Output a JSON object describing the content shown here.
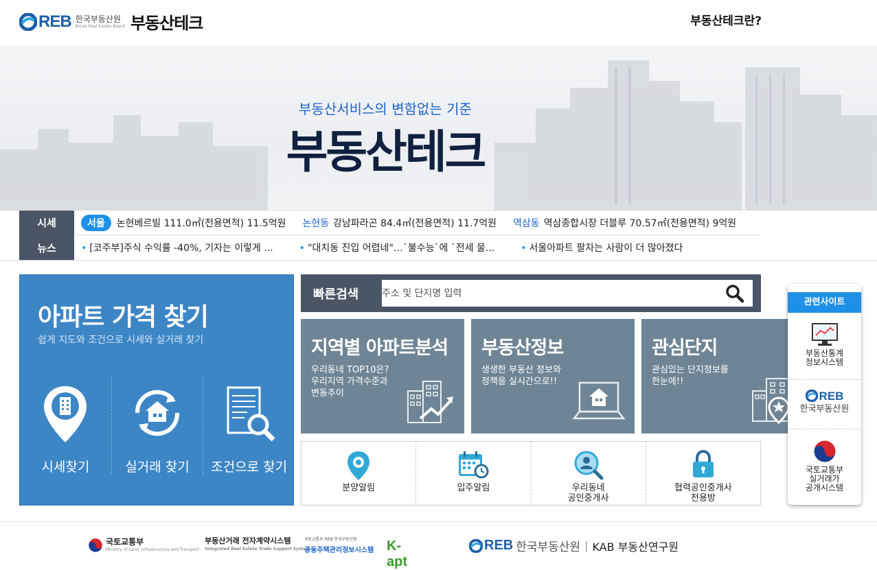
{
  "header": {
    "logo_reb": "REB",
    "logo_kor": "한국부동산원",
    "logo_eng": "Korea Real Estate Board",
    "brand": "부동산테크",
    "about_link": "부동산테크란?"
  },
  "hero": {
    "subtitle": "부동산서비스의 변함없는 기준",
    "title": "부동산테크"
  },
  "ticker": {
    "price_label": "시세",
    "news_label": "뉴스",
    "seoul_pill": "서울",
    "prices": [
      {
        "region": "",
        "text": "논현베르빌  111.0㎡(전용면적)  11.5억원"
      },
      {
        "region": "논현동",
        "text": "강남파라곤  84.4㎡(전용면적)  11.7억원"
      },
      {
        "region": "역삼동",
        "text": "역삼종합시장 더블루  70.57㎡(전용면적)  9억원"
      }
    ],
    "news": [
      "[코주부]주식 수익률 -40%, 기자는 이렇게 ...",
      "\"대치동 진입 어렵네\"…`불수능`에 `전세 물...",
      "서울아파트 팔자는 사람이 더 많아졌다"
    ]
  },
  "apt_panel": {
    "title": "아파트 가격 찾기",
    "subtitle": "쉽게 지도와 조건으로 시세와 실거래 찾기",
    "items": [
      "시세찾기",
      "실거래 찾기",
      "조건으로 찾기"
    ]
  },
  "quick_search": {
    "label": "빠른검색",
    "placeholder": "주소 및 단지명 입력"
  },
  "cards": [
    {
      "title": "지역별 아파트분석",
      "desc": "우리동네 TOP10은?\n우리지역 가격수준과\n변동추이",
      "icon": "chart-building-icon"
    },
    {
      "title": "부동산정보",
      "desc": "생생한 부동산 정보와\n정책을 실시간으로!!",
      "icon": "laptop-house-icon"
    },
    {
      "title": "관심단지",
      "desc": "관심있는 단지정보를\n한눈에!!",
      "icon": "star-building-icon"
    }
  ],
  "icon_links": [
    {
      "label": "분양알림",
      "icon": "location-pin-icon"
    },
    {
      "label": "입주알림",
      "icon": "calendar-clock-icon"
    },
    {
      "label": "우리동네\n공인중개사",
      "icon": "person-search-icon"
    },
    {
      "label": "협력공인중개사\n전용방",
      "icon": "lock-icon"
    }
  ],
  "related": {
    "header": "관련사이트",
    "items": [
      {
        "label": "부동산통계\n정보시스템"
      },
      {
        "label": "한국부동산원"
      },
      {
        "label": "국토교통부\n실거래가\n공개시스템"
      }
    ]
  },
  "footer": {
    "molit": "국토교통부",
    "molit_sub": "Ministry of Land, Infrastructure and Transport",
    "contract": "부동산거래 전자계약시스템",
    "contract_eng": "Integrated Real Estate Trade Support System",
    "kapt_top": "국토교통부  REB 한국부동산원",
    "kapt_name": "공동주택관리정보시스템",
    "kapt": "K-apt",
    "reb": "REB",
    "reb_kor": "한국부동산원",
    "kab": "KAB 부동산연구원"
  },
  "colors": {
    "brand_blue": "#1e64c8",
    "accent_blue": "#1e90e8",
    "panel_blue": "#3d86c6",
    "card_gray": "#6f8595",
    "dark_bar": "#4a5566"
  }
}
